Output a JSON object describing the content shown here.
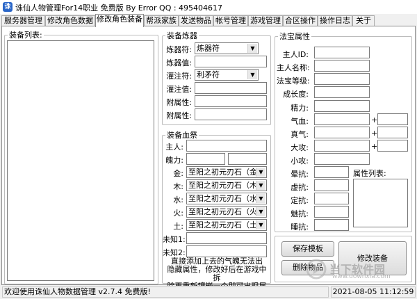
{
  "window": {
    "title": "诛仙人物管理For14职业 免费版 By Error QQ : 495404617"
  },
  "tabs": [
    "服务器管理",
    "修改角色数据",
    "修改角色装备",
    "帮派家族",
    "发送物品",
    "帐号管理",
    "游戏管理",
    "合区操作",
    "操作日志",
    "关于"
  ],
  "equip_list": {
    "title": "装备列表:"
  },
  "refiner": {
    "title": "装备炼器",
    "rune_label": "炼器符:",
    "rune_value": "炼器符",
    "refine_value_label": "炼器值:",
    "infuse_label": "灌注符:",
    "infuse_value": "利矛符",
    "infuse_value_label": "灌注值:",
    "attr1_label": "附属性:",
    "attr2_label": "附属性:"
  },
  "blood": {
    "title": "装备血祭",
    "owner_label": "主人:",
    "soul_label": "魄力:",
    "metal_label": "金:",
    "metal_value": "至阳之初元刃石（金）",
    "wood_label": "木:",
    "wood_value": "至阳之初元刃石（木）",
    "water_label": "水:",
    "water_value": "至阳之初元刃石（水）",
    "fire_label": "火:",
    "fire_value": "至阳之初元刃石（火）",
    "earth_label": "土:",
    "earth_value": "至阳之初元刃石（土）",
    "unknown1_label": "未知1:",
    "unknown2_label": "未知2:",
    "note_line1": "直接添加上去的气魄无法出",
    "note_line2": "隐藏属性，修改好后在游戏中拆",
    "note_line3": "除再重新镶嵌一个即可出现属性"
  },
  "treasure": {
    "title": "法宝属性",
    "id_label": "主人ID:",
    "name_label": "主人名称:",
    "level_label": "法宝等级:",
    "growth_label": "成长度:",
    "energy_label": "精力:",
    "qixue_label": "气血:",
    "zhenqi_label": "真气:",
    "dagong_label": "大攻:",
    "xiaogong_label": "小攻:",
    "yunkang_label": "晕抗:",
    "xukang_label": "虚抗:",
    "dingkang_label": "定抗:",
    "meikang_label": "魅抗:",
    "shuikang_label": "睡抗:",
    "plus": "+",
    "attr_list_label": "属性列表:"
  },
  "buttons": {
    "save_template": "保存模板",
    "delete_item": "删除物品",
    "modify_equip": "修改装备"
  },
  "status": {
    "welcome": "欢迎使用诛仙人物数据管理 v2.7.4 免费版!",
    "datetime": "2021-08-05 11:12:59"
  },
  "watermark": {
    "text": "当下软件园",
    "url": "www.downxia.com"
  }
}
